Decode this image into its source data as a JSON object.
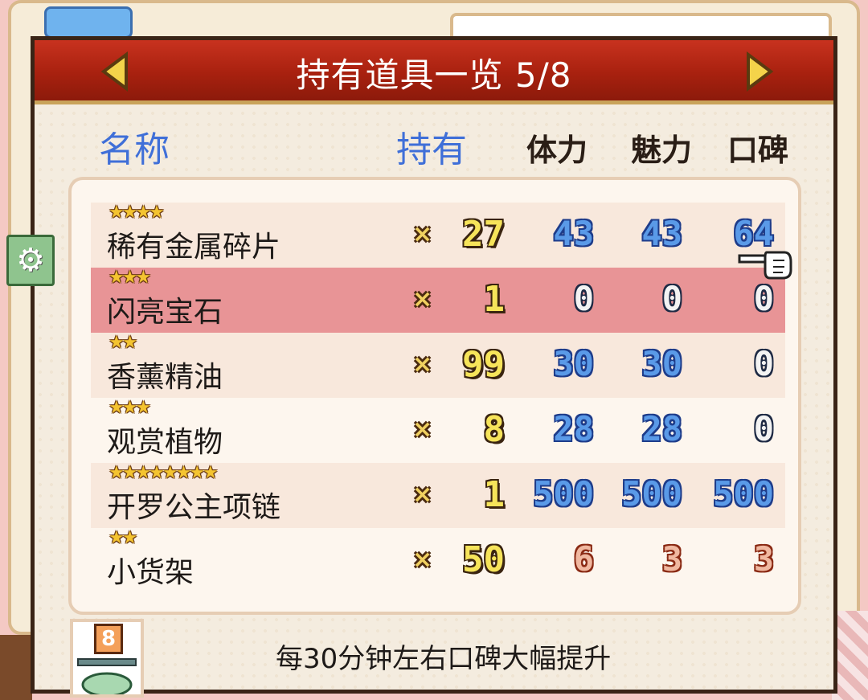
{
  "title": "持有道具一览 5/8",
  "headers": {
    "name": "名称",
    "owned": "持有",
    "stamina": "体力",
    "charm": "魅力",
    "reputation": "口碑"
  },
  "qty_prefix": "×",
  "items": [
    {
      "stars": "★★★★",
      "name": "稀有金属碎片",
      "qty": "27",
      "stamina": "43",
      "charm": "43",
      "reputation": "64",
      "color": "blue",
      "rep_color": "blue"
    },
    {
      "stars": "★★★",
      "name": "闪亮宝石",
      "qty": "1",
      "stamina": "0",
      "charm": "0",
      "reputation": "0",
      "color": "dark",
      "rep_color": "dark"
    },
    {
      "stars": "★★",
      "name": "香薰精油",
      "qty": "99",
      "stamina": "30",
      "charm": "30",
      "reputation": "0",
      "color": "blue",
      "rep_color": "dark"
    },
    {
      "stars": "★★★",
      "name": "观赏植物",
      "qty": "8",
      "stamina": "28",
      "charm": "28",
      "reputation": "0",
      "color": "blue",
      "rep_color": "dark"
    },
    {
      "stars": "★★★★★★★★",
      "name": "开罗公主项链",
      "qty": "1",
      "stamina": "500",
      "charm": "500",
      "reputation": "500",
      "color": "blue",
      "rep_color": "blue"
    },
    {
      "stars": "★★",
      "name": "小货架",
      "qty": "50",
      "stamina": "6",
      "charm": "3",
      "reputation": "3",
      "color": "red",
      "rep_color": "red"
    }
  ],
  "footer": {
    "badge": "8",
    "description": "每30分钟左右口碑大幅提升"
  },
  "icons": {
    "gear": "⚙",
    "arrow_left": "arrow-left-icon",
    "arrow_right": "arrow-right-icon",
    "pointer": "pointing-hand-icon"
  },
  "colors": {
    "title_bar": "#b52a15",
    "header_blue": "#3f6fd8",
    "selected_row": "#e89496",
    "stat_blue": "#5a9ae8"
  }
}
